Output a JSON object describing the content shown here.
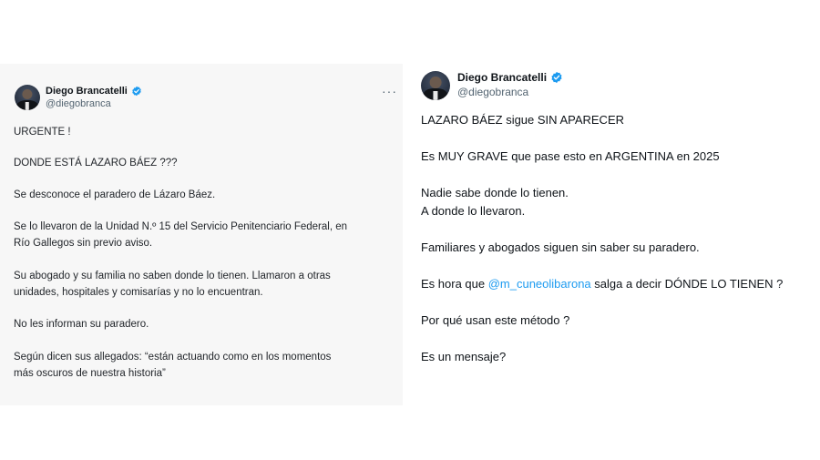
{
  "left_tweet": {
    "author_name": "Diego Brancatelli",
    "author_handle": "@diegobranca",
    "more_label": "···",
    "lines": [
      "URGENTE !",
      "DONDE ESTÁ LAZARO BÁEZ ???",
      "Se desconoce el paradero de Lázaro Báez.",
      "Se lo llevaron de la Unidad N.º 15 del Servicio Penitenciario Federal, en",
      "Río Gallegos sin previo aviso.",
      "Su abogado y su familia no saben donde lo tienen. Llamaron a otras",
      "unidades, hospitales y comisarías y no lo encuentran.",
      "No les informan su paradero.",
      "Según dicen sus allegados: “están actuando como en los momentos",
      "más oscuros de nuestra historia”"
    ]
  },
  "right_tweet": {
    "author_name": "Diego Brancatelli",
    "author_handle": "@diegobranca",
    "lines": [
      "LAZARO BÁEZ sigue SIN APARECER",
      "Es MUY GRAVE que pase esto en ARGENTINA en 2025",
      "Nadie sabe donde lo tienen.",
      "A donde lo llevaron.",
      "Familiares y abogados siguen sin saber su paradero.",
      "Por qué usan este método ?",
      "Es un mensaje?"
    ],
    "mention_line": {
      "prefix": "Es hora que ",
      "mention": "@m_cuneolibarona",
      "suffix": " salga a decir DÓNDE LO TIENEN ?"
    }
  },
  "colors": {
    "verified_blue": "#1d9bf0",
    "mention_blue": "#1d9bf0",
    "left_card_bg": "#f7f7f7",
    "handle_gray": "#536471"
  },
  "icons": {
    "verified": "verified-badge-icon",
    "more": "more-options-icon"
  }
}
